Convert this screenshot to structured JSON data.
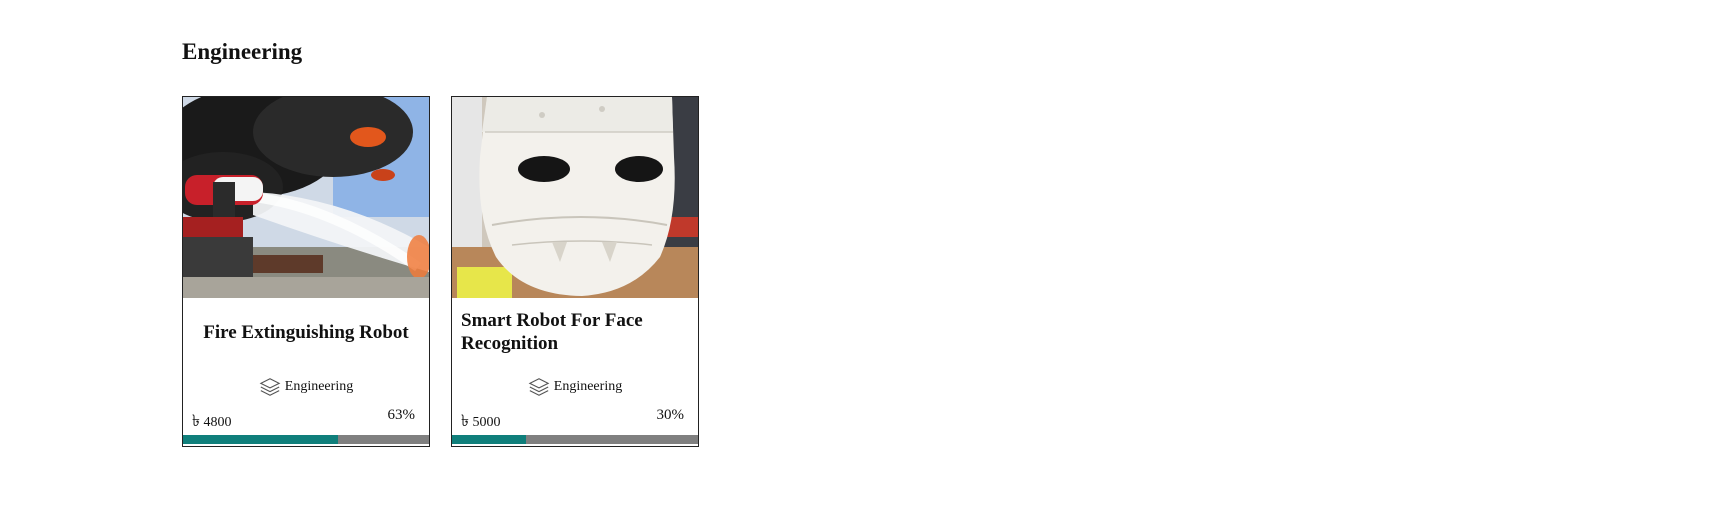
{
  "section": {
    "title": "Engineering"
  },
  "cards": [
    {
      "title": "Fire Extinguishing Robot",
      "category": "Engineering",
      "currency_symbol": "৳",
      "amount": "4800",
      "progress_label": "63%",
      "progress": 0.63,
      "image": "fire-extinguishing-robot-photo"
    },
    {
      "title": "Smart Robot For Face Recognition",
      "category": "Engineering",
      "currency_symbol": "৳",
      "amount": "5000",
      "progress_label": "30%",
      "progress": 0.3,
      "image": "robot-face-photo"
    }
  ],
  "colors": {
    "progress_fill": "#0f7f7b",
    "progress_track": "#808080"
  },
  "icons": {
    "category": "layers-icon"
  }
}
